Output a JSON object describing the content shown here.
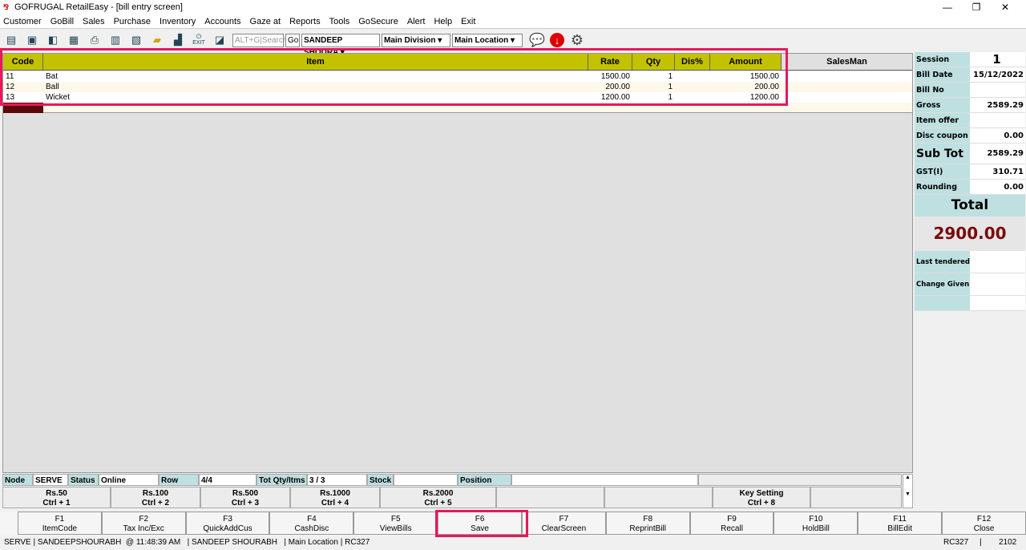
{
  "window": {
    "title": "GOFRUGAL RetailEasy - [bill entry screen]",
    "minimize": "—",
    "maximize": "❐",
    "close": "✕"
  },
  "menu": [
    "Customer",
    "GoBill",
    "Sales",
    "Purchase",
    "Inventory",
    "Accounts",
    "Gaze at",
    "Reports",
    "Tools",
    "GoSecure",
    "Alert",
    "Help",
    "Exit"
  ],
  "toolbar": {
    "search_placeholder": "ALT+G|Search",
    "go": "Go",
    "user": "SANDEEP SHOURA",
    "division": "Main Division",
    "location": "Main Location",
    "exit_label": "EXIT"
  },
  "grid": {
    "headers": [
      "Code",
      "Item",
      "Rate",
      "Qty",
      "Dis%",
      "Amount",
      "SalesMan"
    ],
    "rows": [
      {
        "code": "11",
        "item": "Bat",
        "rate": "1500.00",
        "qty": "1",
        "dis": "",
        "amount": "1500.00",
        "salesman": ""
      },
      {
        "code": "12",
        "item": "Ball",
        "rate": "200.00",
        "qty": "1",
        "dis": "",
        "amount": "200.00",
        "salesman": ""
      },
      {
        "code": "13",
        "item": "Wicket",
        "rate": "1200.00",
        "qty": "1",
        "dis": "",
        "amount": "1200.00",
        "salesman": ""
      }
    ]
  },
  "summary": {
    "session_label": "Session",
    "session": "1",
    "bill_date_label": "Bill Date",
    "bill_date": "15/12/2022",
    "bill_no_label": "Bill No",
    "bill_no": "",
    "gross_label": "Gross",
    "gross": "2589.29",
    "item_offer_label": "Item offer",
    "item_offer": "",
    "disc_coupon_label": "Disc coupon",
    "disc_coupon": "0.00",
    "subtot_label": "Sub Tot",
    "subtot": "2589.29",
    "gst_label": "GST(I)",
    "gst": "310.71",
    "rounding_label": "Rounding",
    "rounding": "0.00",
    "total_label": "Total",
    "total": "2900.00",
    "last_tendered_label": "Last tendered",
    "change_given_label": "Change Given"
  },
  "status": {
    "node_label": "Node",
    "node": "SERVE",
    "status_label": "Status",
    "status": "Online",
    "row_label": "Row",
    "row": "4/4",
    "totqty_label": "Tot Qty/Itms",
    "totqty": "3 / 3",
    "stock_label": "Stock",
    "stock": "",
    "position_label": "Position",
    "position": ""
  },
  "quickkeys": [
    {
      "a": "Rs.50",
      "b": "Ctrl + 1"
    },
    {
      "a": "Rs.100",
      "b": "Ctrl + 2"
    },
    {
      "a": "Rs.500",
      "b": "Ctrl + 3"
    },
    {
      "a": "Rs.1000",
      "b": "Ctrl + 4"
    },
    {
      "a": "Rs.2000",
      "b": "Ctrl + 5"
    },
    {
      "a": "",
      "b": ""
    },
    {
      "a": "",
      "b": ""
    },
    {
      "a": "Key Setting",
      "b": "Ctrl + 8"
    },
    {
      "a": "",
      "b": ""
    }
  ],
  "fkeys": [
    {
      "k": "F1",
      "l": "ItemCode"
    },
    {
      "k": "F2",
      "l": "Tax Inc/Exc"
    },
    {
      "k": "F3",
      "l": "QuickAddCus"
    },
    {
      "k": "F4",
      "l": "CashDisc"
    },
    {
      "k": "F5",
      "l": "ViewBills"
    },
    {
      "k": "F6",
      "l": "Save"
    },
    {
      "k": "F7",
      "l": "ClearScreen"
    },
    {
      "k": "F8",
      "l": "ReprintBill"
    },
    {
      "k": "F9",
      "l": "Recall"
    },
    {
      "k": "F10",
      "l": "HoldBill"
    },
    {
      "k": "F11",
      "l": "BillEdit"
    },
    {
      "k": "F12",
      "l": "Close"
    }
  ],
  "statusbar": {
    "left": "SERVE | SANDEEPSHOURABH  @ 11:48:39 AM   | SANDEEP SHOURABH   | Main Location | RC327",
    "right1": "RC327",
    "sep": "|",
    "right2": "2102"
  }
}
